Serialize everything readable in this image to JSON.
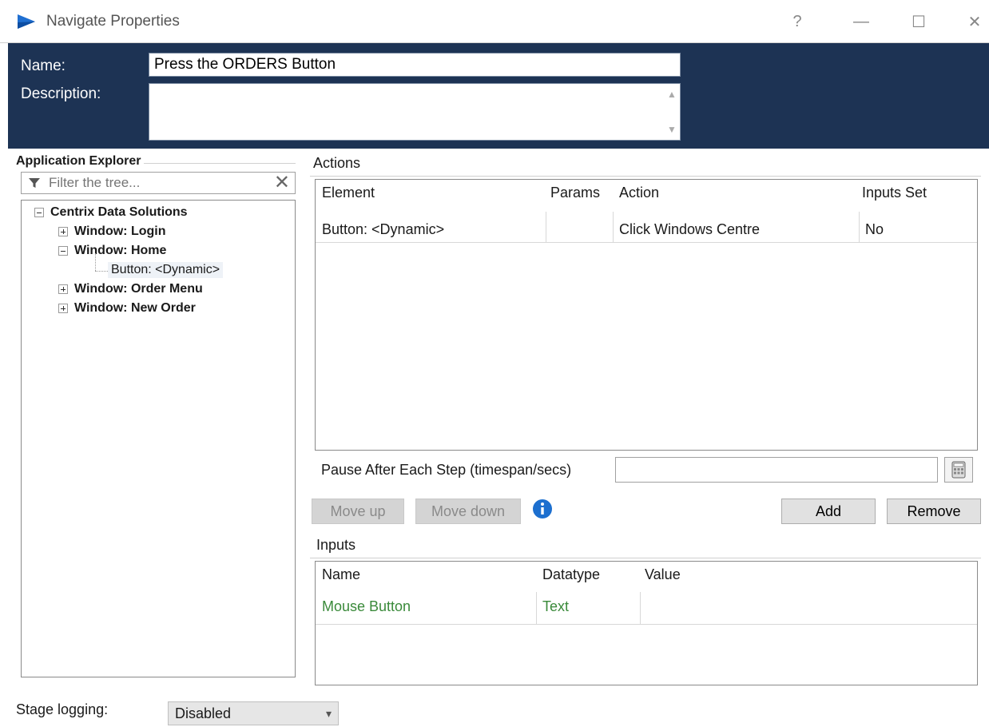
{
  "window": {
    "title": "Navigate Properties",
    "help": "?",
    "minimize": "—",
    "maximize": "☐",
    "close": "✕"
  },
  "header": {
    "name_label": "Name:",
    "name_value": "Press the ORDERS Button",
    "description_label": "Description:",
    "description_value": ""
  },
  "explorer": {
    "title": "Application Explorer",
    "filter_placeholder": "Filter the tree...",
    "nodes": [
      {
        "label": "Centrix Data Solutions",
        "state": "expanded"
      },
      {
        "label": "Window: Login",
        "state": "collapsed"
      },
      {
        "label": "Window: Home",
        "state": "expanded"
      },
      {
        "label": "Button: <Dynamic>",
        "state": "leaf"
      },
      {
        "label": "Window: Order Menu",
        "state": "collapsed"
      },
      {
        "label": "Window: New Order",
        "state": "collapsed"
      }
    ]
  },
  "actions": {
    "title": "Actions",
    "columns": [
      "Element",
      "Params",
      "Action",
      "Inputs Set"
    ],
    "rows": [
      {
        "element": "Button: <Dynamic>",
        "params": "",
        "action": "Click Windows Centre",
        "inputs_set": "No"
      }
    ],
    "pause_label": "Pause After Each Step (timespan/secs)",
    "pause_value": ""
  },
  "buttons": {
    "move_up": "Move up",
    "move_down": "Move down",
    "add": "Add",
    "remove": "Remove"
  },
  "inputs": {
    "title": "Inputs",
    "columns": [
      "Name",
      "Datatype",
      "Value"
    ],
    "rows": [
      {
        "name": "Mouse Button",
        "datatype": "Text",
        "value": ""
      }
    ]
  },
  "footer": {
    "stage_logging_label": "Stage logging:",
    "stage_logging_value": "Disabled"
  },
  "colors": {
    "header_bg": "#1d3354",
    "input_text_green": "#3a8a3a",
    "logo_blue": "#1f6fd1"
  }
}
